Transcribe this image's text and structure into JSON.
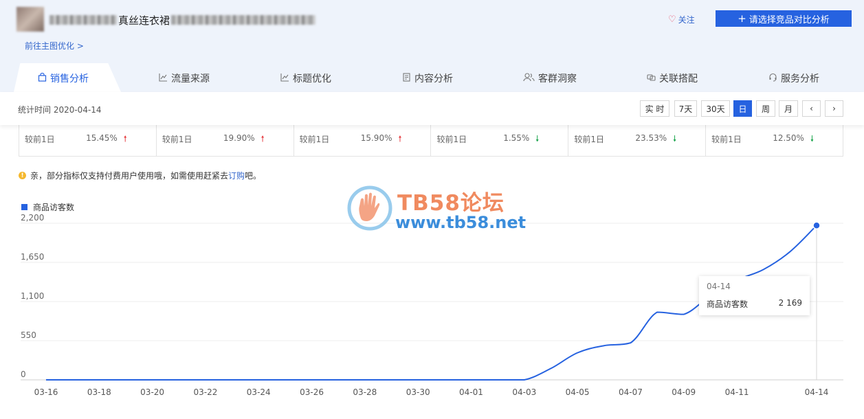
{
  "header": {
    "title_visible": "真丝连衣裙",
    "link_main_image": "前往主图优化 >",
    "follow_label": "关注",
    "compare_button": "请选择竞品对比分析"
  },
  "tabs": [
    {
      "label": "销售分析",
      "icon": "shopping-bag-icon",
      "active": true
    },
    {
      "label": "流量来源",
      "icon": "line-chart-icon"
    },
    {
      "label": "标题优化",
      "icon": "line-chart-icon"
    },
    {
      "label": "内容分析",
      "icon": "document-icon"
    },
    {
      "label": "客群洞察",
      "icon": "users-icon"
    },
    {
      "label": "关联搭配",
      "icon": "link-icon"
    },
    {
      "label": "服务分析",
      "icon": "headset-icon"
    }
  ],
  "toolbar": {
    "stat_time": "统计时间 2020-04-14",
    "periods": [
      "实 时",
      "7天",
      "30天",
      "日",
      "周",
      "月"
    ],
    "active_period": "日",
    "prev_icon": "chevron-left-icon",
    "next_icon": "chevron-right-icon"
  },
  "metrics": [
    {
      "label": "较前1日",
      "value": "15.45%",
      "trend": "up"
    },
    {
      "label": "较前1日",
      "value": "19.90%",
      "trend": "up"
    },
    {
      "label": "较前1日",
      "value": "15.90%",
      "trend": "up"
    },
    {
      "label": "较前1日",
      "value": "1.55%",
      "trend": "down"
    },
    {
      "label": "较前1日",
      "value": "23.53%",
      "trend": "down"
    },
    {
      "label": "较前1日",
      "value": "12.50%",
      "trend": "down"
    }
  ],
  "notice": {
    "text": "亲，部分指标仅支持付费用户使用哦，如需使用赶紧去",
    "link": "订购",
    "suffix": "吧。"
  },
  "watermark": {
    "title": "TB58论坛",
    "url": "www.tb58.net"
  },
  "colors": {
    "accent": "#2662e0",
    "up": "#e5393e",
    "down": "#17a34a",
    "header_bg": "#eef3fb"
  },
  "chart_data": {
    "type": "line",
    "series": [
      {
        "name": "商品访客数",
        "x": [
          "03-16",
          "03-17",
          "03-18",
          "03-19",
          "03-20",
          "03-21",
          "03-22",
          "03-23",
          "03-24",
          "03-25",
          "03-26",
          "03-27",
          "03-28",
          "03-29",
          "03-30",
          "03-31",
          "04-01",
          "04-02",
          "04-03",
          "04-04",
          "04-05",
          "04-06",
          "04-07",
          "04-08",
          "04-09",
          "04-10",
          "04-11",
          "04-12",
          "04-13",
          "04-14"
        ],
        "values": [
          0,
          0,
          0,
          0,
          0,
          0,
          0,
          0,
          0,
          0,
          0,
          0,
          0,
          0,
          0,
          0,
          0,
          0,
          0,
          160,
          380,
          480,
          520,
          950,
          920,
          1180,
          1400,
          1550,
          1800,
          2169
        ]
      }
    ],
    "x_tick_labels": [
      "03-16",
      "03-18",
      "03-20",
      "03-22",
      "03-24",
      "03-26",
      "03-28",
      "03-30",
      "04-01",
      "04-03",
      "04-05",
      "04-07",
      "04-09",
      "04-11",
      "04-14"
    ],
    "y_ticks": [
      "0",
      "550",
      "1,100",
      "1,650",
      "2,200"
    ],
    "ylim": [
      0,
      2200
    ],
    "grid": true,
    "legend_position": "top-left",
    "tooltip": {
      "date": "04-14",
      "name": "商品访客数",
      "value": "2 169"
    }
  }
}
